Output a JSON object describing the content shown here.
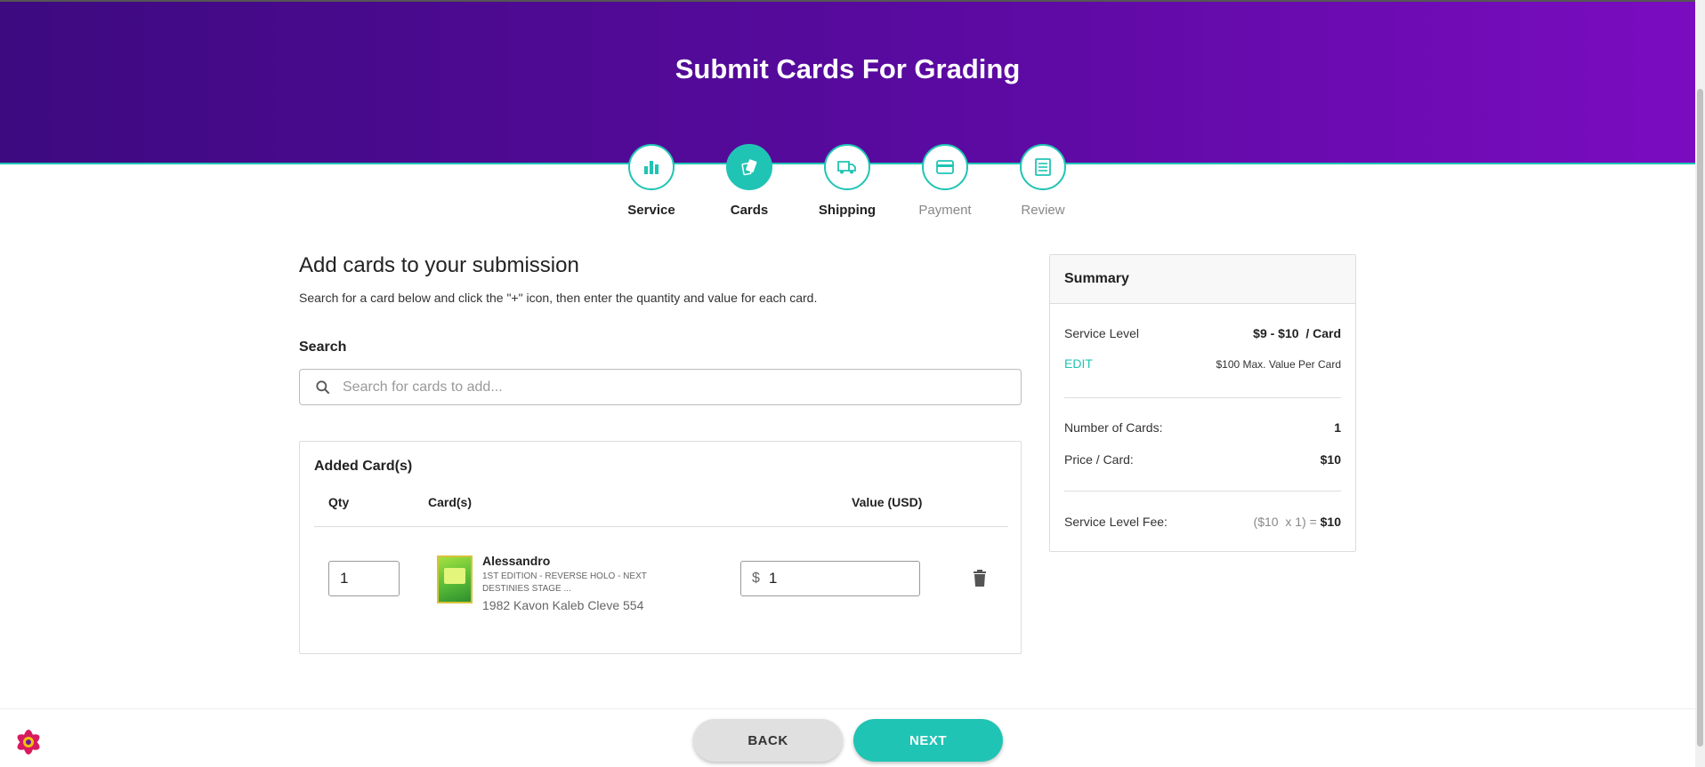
{
  "header": {
    "title": "Submit Cards For Grading"
  },
  "steps": [
    {
      "label": "Service",
      "icon": "bar-chart-icon",
      "state": "done"
    },
    {
      "label": "Cards",
      "icon": "cards-icon",
      "state": "active"
    },
    {
      "label": "Shipping",
      "icon": "truck-icon",
      "state": "done"
    },
    {
      "label": "Payment",
      "icon": "credit-card-icon",
      "state": "future"
    },
    {
      "label": "Review",
      "icon": "list-icon",
      "state": "future"
    }
  ],
  "main": {
    "title": "Add cards to your submission",
    "subtitle": "Search for a card below and click the \"+\" icon, then enter the quantity and value for each card.",
    "search_label": "Search",
    "search_placeholder": "Search for cards to add..."
  },
  "added_cards": {
    "title": "Added Card(s)",
    "columns": {
      "qty": "Qty",
      "cards": "Card(s)",
      "value": "Value (USD)"
    },
    "rows": [
      {
        "qty": "1",
        "name": "Alessandro",
        "description": "1ST EDITION - REVERSE HOLO - NEXT DESTINIES STAGE ...",
        "meta": "1982 Kavon Kaleb Cleve 554",
        "currency": "$",
        "value": "1"
      }
    ]
  },
  "summary": {
    "title": "Summary",
    "service_level_label": "Service Level",
    "service_level_value": "$9 - $10  / Card",
    "edit_label": "EDIT",
    "max_value": "$100 Max. Value Per Card",
    "num_cards_label": "Number of Cards:",
    "num_cards_value": "1",
    "price_label": "Price / Card:",
    "price_value": "$10",
    "fee_label": "Service Level Fee:",
    "fee_formula": "($10  x 1) = ",
    "fee_total": "$10"
  },
  "footer": {
    "back_label": "BACK",
    "next_label": "NEXT"
  },
  "colors": {
    "accent": "#20c4b4",
    "header_start": "#3d0a80",
    "header_end": "#7a0cc0"
  }
}
